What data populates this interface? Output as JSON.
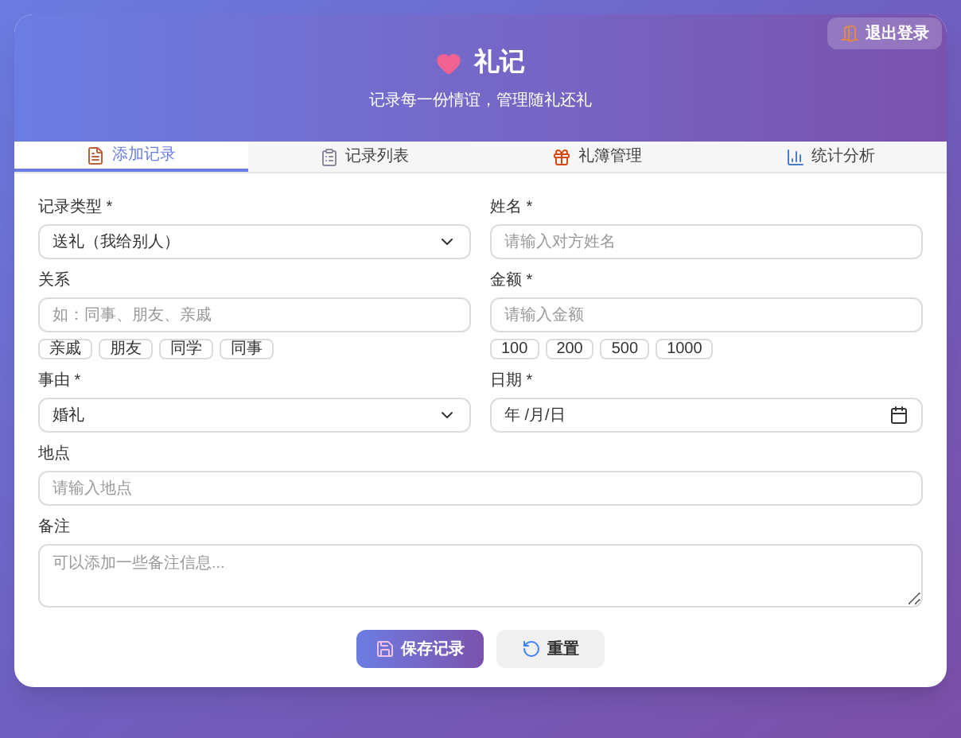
{
  "header": {
    "title": "礼记",
    "subtitle": "记录每一份情谊，管理随礼还礼",
    "logout": "退出登录"
  },
  "tabs": [
    {
      "label": "添加记录",
      "selected": true,
      "kind": "add"
    },
    {
      "label": "记录列表",
      "selected": false,
      "kind": "list"
    },
    {
      "label": "礼簿管理",
      "selected": false,
      "kind": "gift"
    },
    {
      "label": "统计分析",
      "selected": false,
      "kind": "stats"
    }
  ],
  "form": {
    "fields": [
      {
        "kind": "select",
        "label": "记录类型 *",
        "value": "送礼（我给别人）"
      },
      {
        "kind": "input",
        "label": "姓名 *",
        "placeholder": "请输入对方姓名"
      },
      {
        "kind": "input",
        "label": "关系",
        "placeholder": "如：同事、朋友、亲戚",
        "chips": [
          "亲戚",
          "朋友",
          "同学",
          "同事"
        ]
      },
      {
        "kind": "input",
        "label": "金额 *",
        "placeholder": "请输入金额",
        "chips": [
          "100",
          "200",
          "500",
          "1000"
        ]
      },
      {
        "kind": "select",
        "label": "事由 *",
        "value": "婚礼"
      },
      {
        "kind": "date",
        "label": "日期 *",
        "value": "年 /月/日"
      },
      {
        "kind": "input",
        "label": "地点",
        "placeholder": "请输入地点",
        "wide": true
      },
      {
        "kind": "textarea",
        "label": "备注",
        "placeholder": "可以添加一些备注信息...",
        "wide": true
      }
    ],
    "buttons": [
      {
        "label": "保存记录",
        "kind": "primary"
      },
      {
        "label": "重置",
        "kind": "secondary"
      }
    ]
  }
}
